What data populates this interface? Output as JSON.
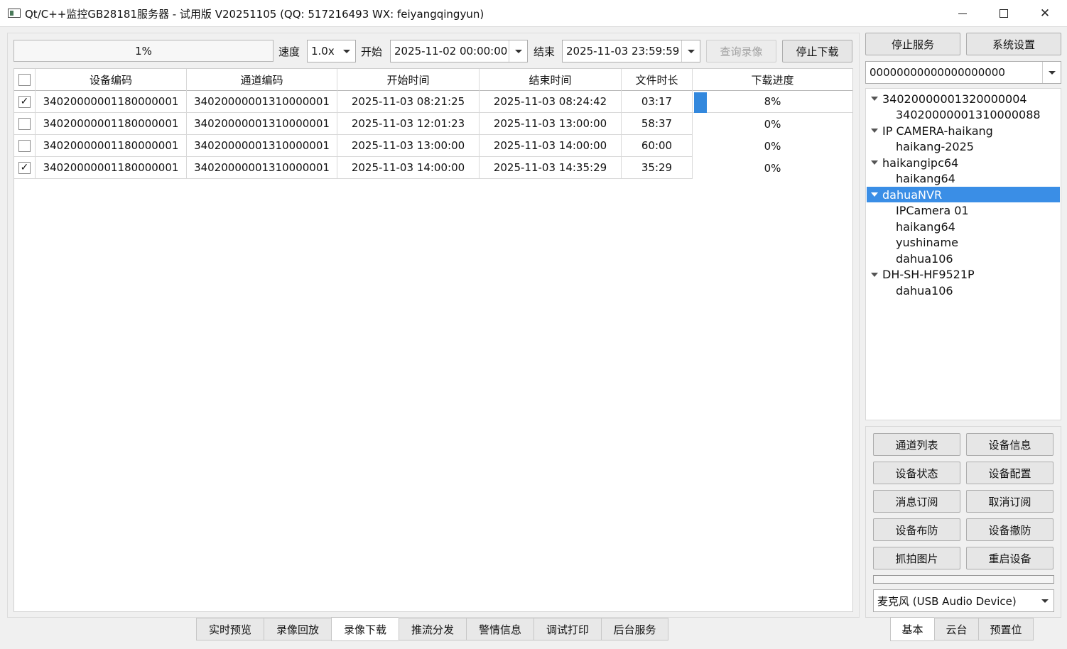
{
  "window": {
    "title": "Qt/C++监控GB28181服务器 - 试用版 V20251105 (QQ: 517216493 WX: feiyangqingyun)"
  },
  "toolbar": {
    "progress_text": "1%",
    "speed_label": "速度",
    "speed_value": "1.0x",
    "start_label": "开始",
    "start_value": "2025-11-02 00:00:00",
    "end_label": "结束",
    "end_value": "2025-11-03 23:59:59",
    "query_label": "查询录像",
    "stop_download_label": "停止下载"
  },
  "table": {
    "headers": [
      "设备编码",
      "通道编码",
      "开始时间",
      "结束时间",
      "文件时长",
      "下载进度"
    ],
    "rows": [
      {
        "checked": true,
        "device": "34020000001180000001",
        "channel": "34020000001310000001",
        "start": "2025-11-03 08:21:25",
        "end": "2025-11-03 08:24:42",
        "duration": "03:17",
        "progress": "8%",
        "progress_value": 0.08
      },
      {
        "checked": false,
        "device": "34020000001180000001",
        "channel": "34020000001310000001",
        "start": "2025-11-03 12:01:23",
        "end": "2025-11-03 13:00:00",
        "duration": "58:37",
        "progress": "0%",
        "progress_value": 0
      },
      {
        "checked": false,
        "device": "34020000001180000001",
        "channel": "34020000001310000001",
        "start": "2025-11-03 13:00:00",
        "end": "2025-11-03 14:00:00",
        "duration": "60:00",
        "progress": "0%",
        "progress_value": 0
      },
      {
        "checked": true,
        "device": "34020000001180000001",
        "channel": "34020000001310000001",
        "start": "2025-11-03 14:00:00",
        "end": "2025-11-03 14:35:29",
        "duration": "35:29",
        "progress": "0%",
        "progress_value": 0
      }
    ],
    "check_mark": "✓"
  },
  "main_tabs": [
    "实时预览",
    "录像回放",
    "录像下载",
    "推流分发",
    "警情信息",
    "调试打印",
    "后台服务"
  ],
  "main_tab_active": 2,
  "right": {
    "stop_service_label": "停止服务",
    "settings_label": "系统设置",
    "device_combo_value": "00000000000000000000",
    "tree": [
      {
        "label": "34020000001320000004",
        "level": 0,
        "expanded": true,
        "selected": false
      },
      {
        "label": "34020000001310000088",
        "level": 1,
        "expanded": false,
        "selected": false
      },
      {
        "label": "IP CAMERA-haikang",
        "level": 0,
        "expanded": true,
        "selected": false
      },
      {
        "label": "haikang-2025",
        "level": 1,
        "expanded": false,
        "selected": false
      },
      {
        "label": "haikangipc64",
        "level": 0,
        "expanded": true,
        "selected": false
      },
      {
        "label": "haikang64",
        "level": 1,
        "expanded": false,
        "selected": false
      },
      {
        "label": "dahuaNVR",
        "level": 0,
        "expanded": true,
        "selected": true
      },
      {
        "label": "IPCamera 01",
        "level": 1,
        "expanded": false,
        "selected": false
      },
      {
        "label": "haikang64",
        "level": 1,
        "expanded": false,
        "selected": false
      },
      {
        "label": "yushiname",
        "level": 1,
        "expanded": false,
        "selected": false
      },
      {
        "label": "dahua106",
        "level": 1,
        "expanded": false,
        "selected": false
      },
      {
        "label": "DH-SH-HF9521P",
        "level": 0,
        "expanded": true,
        "selected": false
      },
      {
        "label": "dahua106",
        "level": 1,
        "expanded": false,
        "selected": false
      }
    ],
    "actions": [
      "通道列表",
      "设备信息",
      "设备状态",
      "设备配置",
      "消息订阅",
      "取消订阅",
      "设备布防",
      "设备撤防",
      "抓拍图片",
      "重启设备"
    ],
    "mic_value": "麦克风 (USB Audio Device)",
    "tabs": [
      "基本",
      "云台",
      "预置位"
    ],
    "tab_active": 0
  },
  "colors": {
    "accent": "#3a8ee6",
    "progress_fill": "#3388dd"
  }
}
